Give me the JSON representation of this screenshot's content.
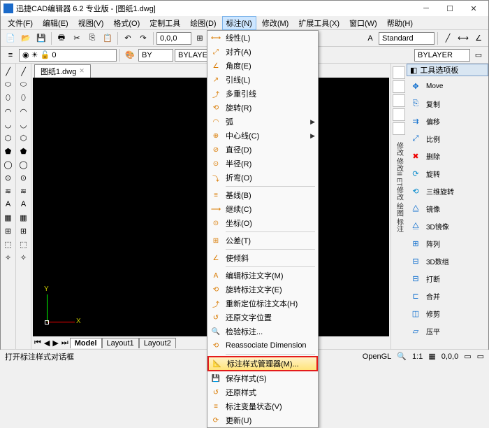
{
  "title": "迅捷CAD编辑器 6.2 专业版 - [图纸1.dwg]",
  "menu": [
    "文件(F)",
    "编辑(E)",
    "视图(V)",
    "格式(O)",
    "定制工具",
    "绘图(D)",
    "标注(N)",
    "修改(M)",
    "扩展工具(X)",
    "窗口(W)",
    "帮助(H)"
  ],
  "active_menu_index": 6,
  "toolbar2": {
    "standard": "Standard",
    "bylayer": "BYLAYER",
    "bylayer2": "BYLAYER"
  },
  "toolbar_combo": {
    "bycolor": "BY",
    "bymid": "BYLAYER"
  },
  "doc_tab": "图纸1.dwg",
  "layout_tabs": [
    "Model",
    "Layout1",
    "Layout2"
  ],
  "ucs": {
    "x": "X",
    "y": "Y"
  },
  "right_header": "工具选项板",
  "right_items": [
    {
      "icon": "move",
      "label": "Move"
    },
    {
      "icon": "copy",
      "label": "复制"
    },
    {
      "icon": "offset",
      "label": "偏移"
    },
    {
      "icon": "scale",
      "label": "比例"
    },
    {
      "icon": "delete",
      "label": "删除"
    },
    {
      "icon": "rotate",
      "label": "旋转"
    },
    {
      "icon": "rotate3d",
      "label": "三维旋转"
    },
    {
      "icon": "mirror",
      "label": "镜像"
    },
    {
      "icon": "mirror3d",
      "label": "3D镜像"
    },
    {
      "icon": "array",
      "label": "阵列"
    },
    {
      "icon": "array3d",
      "label": "3D数组"
    },
    {
      "icon": "break",
      "label": "打断"
    },
    {
      "icon": "join",
      "label": "合并"
    },
    {
      "icon": "chamfer",
      "label": "修剪"
    },
    {
      "icon": "extend",
      "label": "压平"
    }
  ],
  "right_vtext": [
    "修改",
    "修改II",
    "ET修改",
    "绘图",
    "标注"
  ],
  "dropdown": [
    {
      "label": "线性(L)",
      "t": "item"
    },
    {
      "label": "对齐(A)",
      "t": "item"
    },
    {
      "label": "角度(E)",
      "t": "item"
    },
    {
      "label": "引线(L)",
      "t": "item"
    },
    {
      "label": "多重引线",
      "t": "item"
    },
    {
      "label": "旋转(R)",
      "t": "item"
    },
    {
      "label": "弧",
      "t": "sub"
    },
    {
      "label": "中心线(C)",
      "t": "sub"
    },
    {
      "label": "直径(D)",
      "t": "item"
    },
    {
      "label": "半径(R)",
      "t": "item"
    },
    {
      "label": "折弯(O)",
      "t": "item"
    },
    {
      "t": "sep"
    },
    {
      "label": "基线(B)",
      "t": "item"
    },
    {
      "label": "继续(C)",
      "t": "item"
    },
    {
      "label": "坐标(O)",
      "t": "item"
    },
    {
      "t": "sep"
    },
    {
      "label": "公差(T)",
      "t": "item"
    },
    {
      "t": "sep"
    },
    {
      "label": "使倾斜",
      "t": "item"
    },
    {
      "t": "sep"
    },
    {
      "label": "编辑标注文字(M)",
      "t": "item"
    },
    {
      "label": "旋转标注文字(E)",
      "t": "item"
    },
    {
      "label": "重新定位标注文本(H)",
      "t": "item"
    },
    {
      "label": "还原文字位置",
      "t": "item"
    },
    {
      "label": "检验标注...",
      "t": "item"
    },
    {
      "label": "Reassociate Dimension",
      "t": "item"
    },
    {
      "t": "sep"
    },
    {
      "label": "标注样式管理器(M)...",
      "t": "highlight"
    },
    {
      "label": "保存样式(S)",
      "t": "item"
    },
    {
      "label": "还原样式",
      "t": "item"
    },
    {
      "label": "标注变量状态(V)",
      "t": "item"
    },
    {
      "label": "更新(U)",
      "t": "item"
    }
  ],
  "status": {
    "left": "打开标注样式对话框",
    "gl": "OpenGL",
    "ratio": "1:1",
    "coord": "0,0,0"
  }
}
